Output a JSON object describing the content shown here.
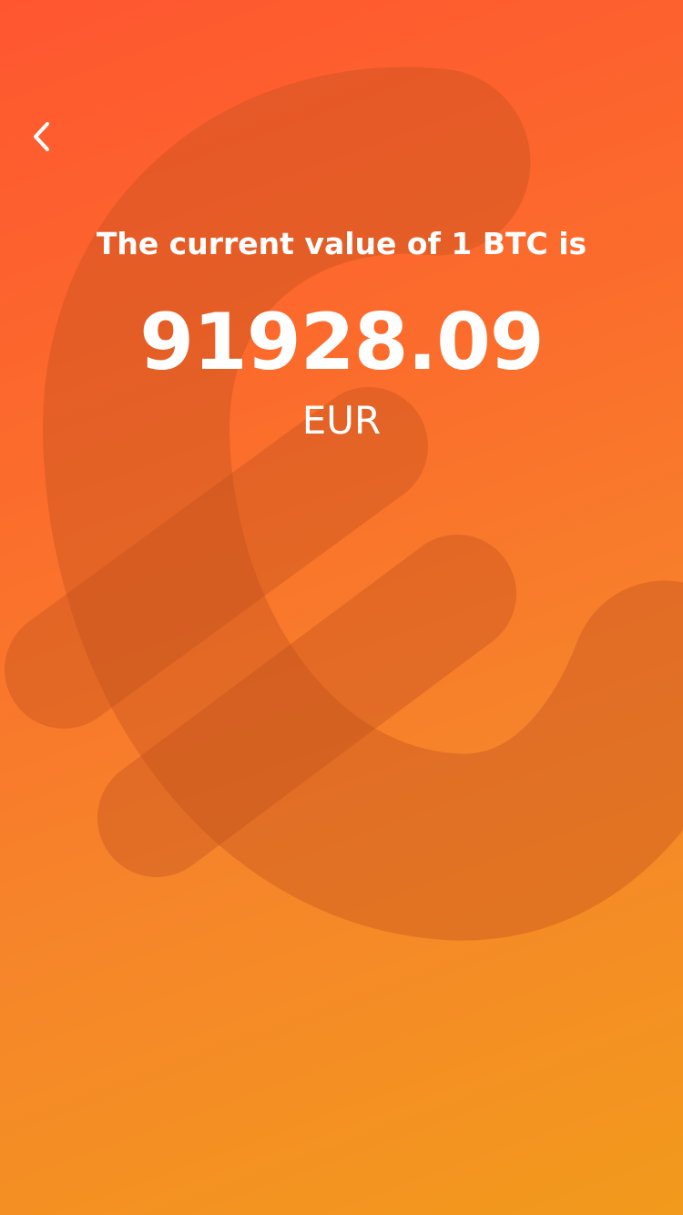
{
  "background": {
    "symbol_icon": "euro-icon",
    "gradient_start": "#ff5630",
    "gradient_end": "#f29a1c",
    "symbol_color": "#c04f1c"
  },
  "nav": {
    "back_icon": "chevron-left-icon"
  },
  "result": {
    "heading": "The current value of 1 BTC is",
    "price": "91928.09",
    "currency": "EUR"
  }
}
